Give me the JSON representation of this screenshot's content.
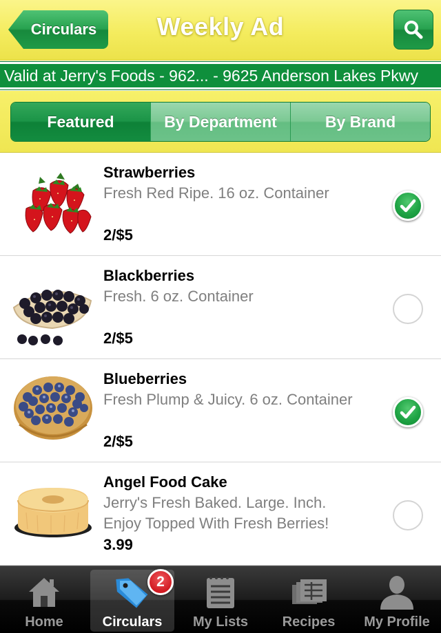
{
  "header": {
    "back_label": "Circulars",
    "title": "Weekly Ad",
    "search_icon": "search-icon"
  },
  "banner": {
    "valid_text": "Valid at Jerry's Foods - 962... - 9625 Anderson Lakes Pkwy"
  },
  "segments": [
    {
      "label": "Featured",
      "active": true
    },
    {
      "label": "By Department",
      "active": false
    },
    {
      "label": "By Brand",
      "active": false
    }
  ],
  "items": [
    {
      "name": "Strawberries",
      "desc": "Fresh Red Ripe. 16 oz. Container",
      "price": "2/$5",
      "checked": true,
      "image": "strawberries"
    },
    {
      "name": "Blackberries",
      "desc": "Fresh. 6 oz. Container",
      "price": "2/$5",
      "checked": false,
      "image": "blackberries"
    },
    {
      "name": "Blueberries",
      "desc": "Fresh Plump & Juicy. 6 oz. Container",
      "price": "2/$5",
      "checked": true,
      "image": "blueberries"
    },
    {
      "name": "Angel Food Cake",
      "desc": "Jerry's Fresh Baked. Large. Inch. Enjoy Topped With Fresh Berries!",
      "price": "3.99",
      "checked": false,
      "image": "angel-food-cake"
    }
  ],
  "tabbar": {
    "tabs": [
      {
        "label": "Home",
        "icon": "home-icon",
        "active": false
      },
      {
        "label": "Circulars",
        "icon": "tag-icon",
        "active": true
      },
      {
        "label": "My Lists",
        "icon": "list-icon",
        "active": false
      },
      {
        "label": "Recipes",
        "icon": "recipes-icon",
        "active": false
      },
      {
        "label": "My Profile",
        "icon": "profile-icon",
        "active": false
      }
    ],
    "lists_badge": "2"
  },
  "colors": {
    "header_yellow": "#f4ec5e",
    "brand_green": "#0f8f3c",
    "check_green": "#1fa445",
    "badge_red": "#d11a22"
  }
}
